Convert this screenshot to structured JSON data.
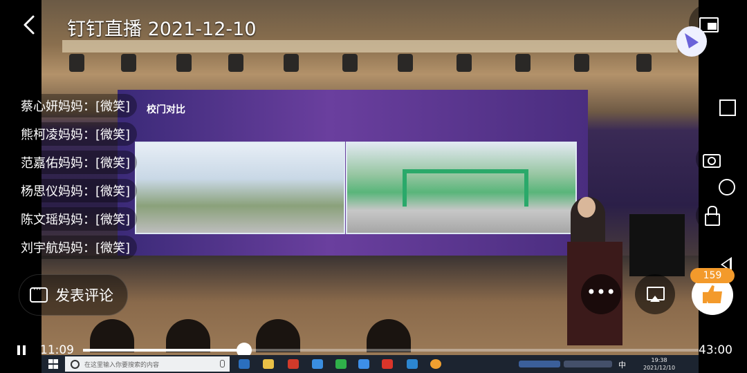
{
  "header": {
    "title": "钉钉直播 2021-12-10"
  },
  "comments": [
    {
      "user": "蔡心妍妈妈",
      "sep": "：",
      "text": "[微笑]"
    },
    {
      "user": "熊柯凌妈妈",
      "sep": "：",
      "text": "[微笑]"
    },
    {
      "user": "范嘉佑妈妈",
      "sep": "：",
      "text": "[微笑]"
    },
    {
      "user": "杨思仪妈妈",
      "sep": "：",
      "text": "[微笑]"
    },
    {
      "user": "陈文瑶妈妈",
      "sep": "：",
      "text": "[微笑]"
    },
    {
      "user": "刘宇航妈妈",
      "sep": "：",
      "text": "[微笑]"
    }
  ],
  "post_comment": {
    "label": "发表评论"
  },
  "video": {
    "slide_title": "校门对比"
  },
  "controls": {
    "like_count": "159",
    "more_label": "•••"
  },
  "playback": {
    "current_time": "11:09",
    "total_time": "43:00",
    "progress": 0.262
  },
  "taskbar": {
    "search_placeholder": "在这里输入你要搜索的内容",
    "ime": "中",
    "clock_time": "19:38",
    "clock_date": "2021/12/10"
  },
  "colors": {
    "accent_like": "#f39a2b",
    "overlay": "rgba(0,0,0,0.45)"
  }
}
